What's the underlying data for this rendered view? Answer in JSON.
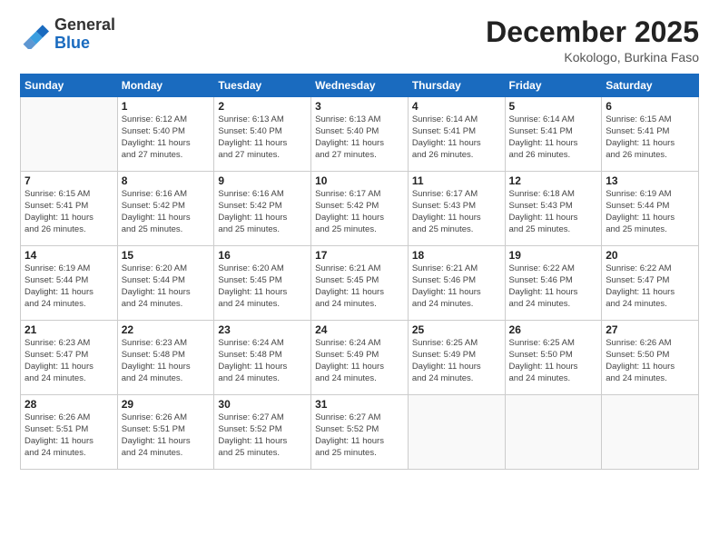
{
  "logo": {
    "general": "General",
    "blue": "Blue"
  },
  "header": {
    "title": "December 2025",
    "location": "Kokologo, Burkina Faso"
  },
  "weekdays": [
    "Sunday",
    "Monday",
    "Tuesday",
    "Wednesday",
    "Thursday",
    "Friday",
    "Saturday"
  ],
  "weeks": [
    [
      {
        "day": "",
        "info": ""
      },
      {
        "day": "1",
        "info": "Sunrise: 6:12 AM\nSunset: 5:40 PM\nDaylight: 11 hours\nand 27 minutes."
      },
      {
        "day": "2",
        "info": "Sunrise: 6:13 AM\nSunset: 5:40 PM\nDaylight: 11 hours\nand 27 minutes."
      },
      {
        "day": "3",
        "info": "Sunrise: 6:13 AM\nSunset: 5:40 PM\nDaylight: 11 hours\nand 27 minutes."
      },
      {
        "day": "4",
        "info": "Sunrise: 6:14 AM\nSunset: 5:41 PM\nDaylight: 11 hours\nand 26 minutes."
      },
      {
        "day": "5",
        "info": "Sunrise: 6:14 AM\nSunset: 5:41 PM\nDaylight: 11 hours\nand 26 minutes."
      },
      {
        "day": "6",
        "info": "Sunrise: 6:15 AM\nSunset: 5:41 PM\nDaylight: 11 hours\nand 26 minutes."
      }
    ],
    [
      {
        "day": "7",
        "info": "Sunrise: 6:15 AM\nSunset: 5:41 PM\nDaylight: 11 hours\nand 26 minutes."
      },
      {
        "day": "8",
        "info": "Sunrise: 6:16 AM\nSunset: 5:42 PM\nDaylight: 11 hours\nand 25 minutes."
      },
      {
        "day": "9",
        "info": "Sunrise: 6:16 AM\nSunset: 5:42 PM\nDaylight: 11 hours\nand 25 minutes."
      },
      {
        "day": "10",
        "info": "Sunrise: 6:17 AM\nSunset: 5:42 PM\nDaylight: 11 hours\nand 25 minutes."
      },
      {
        "day": "11",
        "info": "Sunrise: 6:17 AM\nSunset: 5:43 PM\nDaylight: 11 hours\nand 25 minutes."
      },
      {
        "day": "12",
        "info": "Sunrise: 6:18 AM\nSunset: 5:43 PM\nDaylight: 11 hours\nand 25 minutes."
      },
      {
        "day": "13",
        "info": "Sunrise: 6:19 AM\nSunset: 5:44 PM\nDaylight: 11 hours\nand 25 minutes."
      }
    ],
    [
      {
        "day": "14",
        "info": "Sunrise: 6:19 AM\nSunset: 5:44 PM\nDaylight: 11 hours\nand 24 minutes."
      },
      {
        "day": "15",
        "info": "Sunrise: 6:20 AM\nSunset: 5:44 PM\nDaylight: 11 hours\nand 24 minutes."
      },
      {
        "day": "16",
        "info": "Sunrise: 6:20 AM\nSunset: 5:45 PM\nDaylight: 11 hours\nand 24 minutes."
      },
      {
        "day": "17",
        "info": "Sunrise: 6:21 AM\nSunset: 5:45 PM\nDaylight: 11 hours\nand 24 minutes."
      },
      {
        "day": "18",
        "info": "Sunrise: 6:21 AM\nSunset: 5:46 PM\nDaylight: 11 hours\nand 24 minutes."
      },
      {
        "day": "19",
        "info": "Sunrise: 6:22 AM\nSunset: 5:46 PM\nDaylight: 11 hours\nand 24 minutes."
      },
      {
        "day": "20",
        "info": "Sunrise: 6:22 AM\nSunset: 5:47 PM\nDaylight: 11 hours\nand 24 minutes."
      }
    ],
    [
      {
        "day": "21",
        "info": "Sunrise: 6:23 AM\nSunset: 5:47 PM\nDaylight: 11 hours\nand 24 minutes."
      },
      {
        "day": "22",
        "info": "Sunrise: 6:23 AM\nSunset: 5:48 PM\nDaylight: 11 hours\nand 24 minutes."
      },
      {
        "day": "23",
        "info": "Sunrise: 6:24 AM\nSunset: 5:48 PM\nDaylight: 11 hours\nand 24 minutes."
      },
      {
        "day": "24",
        "info": "Sunrise: 6:24 AM\nSunset: 5:49 PM\nDaylight: 11 hours\nand 24 minutes."
      },
      {
        "day": "25",
        "info": "Sunrise: 6:25 AM\nSunset: 5:49 PM\nDaylight: 11 hours\nand 24 minutes."
      },
      {
        "day": "26",
        "info": "Sunrise: 6:25 AM\nSunset: 5:50 PM\nDaylight: 11 hours\nand 24 minutes."
      },
      {
        "day": "27",
        "info": "Sunrise: 6:26 AM\nSunset: 5:50 PM\nDaylight: 11 hours\nand 24 minutes."
      }
    ],
    [
      {
        "day": "28",
        "info": "Sunrise: 6:26 AM\nSunset: 5:51 PM\nDaylight: 11 hours\nand 24 minutes."
      },
      {
        "day": "29",
        "info": "Sunrise: 6:26 AM\nSunset: 5:51 PM\nDaylight: 11 hours\nand 24 minutes."
      },
      {
        "day": "30",
        "info": "Sunrise: 6:27 AM\nSunset: 5:52 PM\nDaylight: 11 hours\nand 25 minutes."
      },
      {
        "day": "31",
        "info": "Sunrise: 6:27 AM\nSunset: 5:52 PM\nDaylight: 11 hours\nand 25 minutes."
      },
      {
        "day": "",
        "info": ""
      },
      {
        "day": "",
        "info": ""
      },
      {
        "day": "",
        "info": ""
      }
    ]
  ]
}
